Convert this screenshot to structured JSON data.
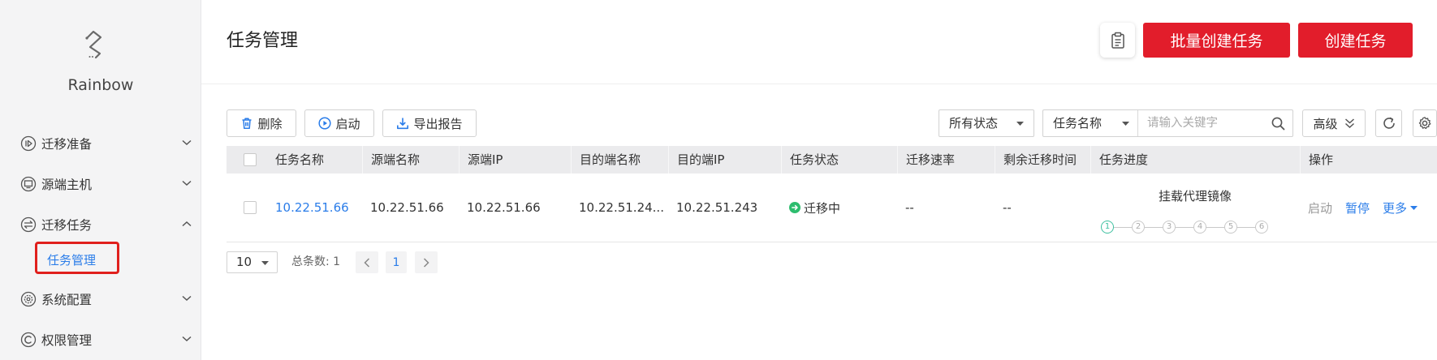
{
  "app": {
    "name": "Rainbow",
    "logo_icon": "route-logo-icon"
  },
  "colors": {
    "brand_red": "#e21d2b",
    "link_blue": "#2b7de9",
    "status_green": "#2dbd6e",
    "step_active": "#3fc0a0",
    "sidebar_bg": "#f4f4f5",
    "table_header_bg": "#ebebed"
  },
  "sidebar": {
    "items": [
      {
        "label": "迁移准备",
        "icon": "prepare-icon",
        "expanded": false
      },
      {
        "label": "源端主机",
        "icon": "monitor-icon",
        "expanded": false
      },
      {
        "label": "迁移任务",
        "icon": "swap-icon",
        "expanded": true,
        "children": [
          {
            "label": "任务管理",
            "active": true
          }
        ]
      },
      {
        "label": "系统配置",
        "icon": "settings-icon",
        "expanded": false
      },
      {
        "label": "权限管理",
        "icon": "permission-icon",
        "expanded": false
      }
    ]
  },
  "header": {
    "title": "任务管理",
    "clipboard_icon": "clipboard-icon",
    "batch_create_label": "批量创建任务",
    "create_label": "创建任务"
  },
  "toolbar": {
    "delete_label": "删除",
    "start_label": "启动",
    "export_label": "导出报告",
    "status_filter": "所有状态",
    "search_field": "任务名称",
    "search_placeholder": "请输入关键字",
    "advanced_label": "高级"
  },
  "table": {
    "columns": [
      "任务名称",
      "源端名称",
      "源端IP",
      "目的端名称",
      "目的端IP",
      "任务状态",
      "迁移速率",
      "剩余迁移时间",
      "任务进度",
      "操作"
    ],
    "rows": [
      {
        "task_name": "10.22.51.66",
        "source_name": "10.22.51.66",
        "source_ip": "10.22.51.66",
        "target_name": "10.22.51.24...",
        "target_ip": "10.22.51.243",
        "status": "迁移中",
        "status_icon": "migrating-icon",
        "rate": "--",
        "remaining_time": "--",
        "progress": {
          "stage_label": "挂载代理镜像",
          "steps": [
            "1",
            "2",
            "3",
            "4",
            "5",
            "6"
          ],
          "current_step": 1
        },
        "actions": [
          "启动",
          "暂停",
          "更多"
        ],
        "selected": false
      }
    ]
  },
  "pagination": {
    "page_size": "10",
    "total_label": "总条数: 1",
    "current_page": "1"
  }
}
